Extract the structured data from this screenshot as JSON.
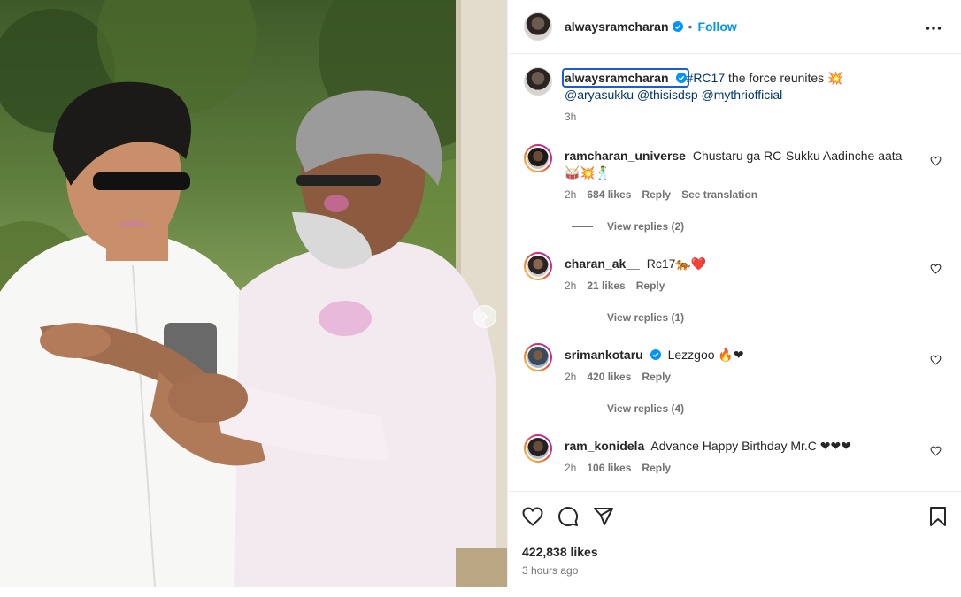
{
  "post": {
    "username": "alwaysramcharan",
    "follow_label": "Follow",
    "separator": "•",
    "caption": {
      "username": "alwaysramcharan",
      "hashtag": "#RC17",
      "text": " the force reunites 💥",
      "mentions": [
        "@aryasukku",
        "@thisisdsp",
        "@mythriofficial"
      ],
      "time": "3h"
    }
  },
  "comments": [
    {
      "username": "ramcharan_universe",
      "text": "Chustaru ga RC-Sukku Aadinche aata 🥁💥🕺",
      "time": "2h",
      "likes": "684 likes",
      "reply_label": "Reply",
      "translation_label": "See translation",
      "view_replies": "View replies (2)",
      "verified": false
    },
    {
      "username": "charan_ak__",
      "text": "Rc17🐅❤️",
      "time": "2h",
      "likes": "21 likes",
      "reply_label": "Reply",
      "view_replies": "View replies (1)",
      "verified": false
    },
    {
      "username": "srimankotaru",
      "text": "Lezzgoo 🔥❤",
      "time": "2h",
      "likes": "420 likes",
      "reply_label": "Reply",
      "view_replies": "View replies (4)",
      "verified": true
    },
    {
      "username": "ram_konidela",
      "text": "Advance Happy Birthday Mr.C ❤❤❤",
      "time": "2h",
      "likes": "106 likes",
      "reply_label": "Reply",
      "verified": false
    }
  ],
  "footer": {
    "likes": "422,838 likes",
    "time_ago": "3 hours ago"
  },
  "icons": {
    "like": "heart-icon",
    "comment": "comment-icon",
    "share": "share-icon",
    "save": "bookmark-icon",
    "more": "more-options-icon",
    "verified": "verified-badge-icon",
    "next": "chevron-right-icon"
  },
  "colors": {
    "follow": "#0095f6",
    "verified": "#0095f6",
    "link": "#00376b",
    "highlight": "#1e5bd0"
  }
}
